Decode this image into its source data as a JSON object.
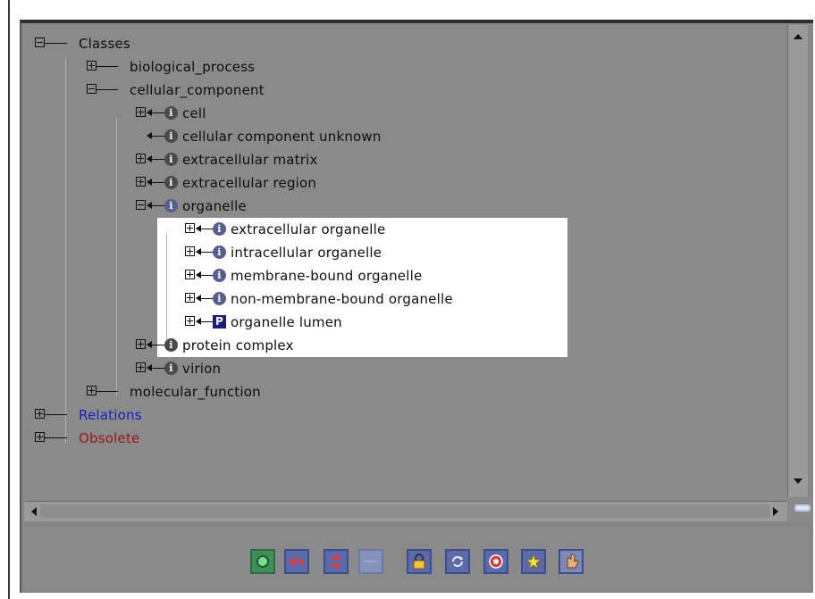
{
  "tree": {
    "classes": "Classes",
    "biological_process": "biological_process",
    "cellular_component": "cellular_component",
    "cell": "cell",
    "cellular_component_unknown": "cellular component unknown",
    "extracellular_matrix": "extracellular matrix",
    "extracellular_region": "extracellular region",
    "organelle": "organelle",
    "extracellular_organelle": "extracellular organelle",
    "intracellular_organelle": "intracellular organelle",
    "membrane_bound_organelle": "membrane-bound organelle",
    "non_membrane_bound_organelle": "non-membrane-bound organelle",
    "organelle_lumen": "organelle lumen",
    "protein_complex": "protein complex",
    "virion": "virion",
    "molecular_function": "molecular_function",
    "relations": "Relations",
    "obsolete": "Obsolete"
  },
  "icons": {
    "info_glyph": "i",
    "property_glyph": "P",
    "tool_names": [
      "green-circle-icon",
      "horizontal-arrows-icon",
      "vertical-arrows-icon",
      "blank-tool-icon",
      "lock-icon",
      "refresh-icon",
      "target-icon",
      "star-icon",
      "hand-pointer-icon"
    ]
  },
  "colors": {
    "relations_link": "#1c1cc4",
    "obsolete_link": "#a01414",
    "tree_background": "#8a8a8a",
    "selection_background": "#ffffff"
  }
}
